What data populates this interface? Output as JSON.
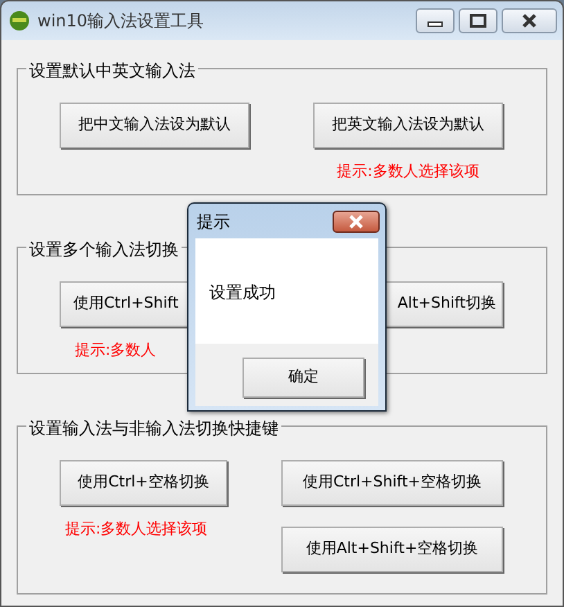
{
  "window": {
    "title": "win10输入法设置工具"
  },
  "groups": [
    {
      "title": "设置默认中英文输入法",
      "buttons": [
        {
          "label": "把中文输入法设为默认"
        },
        {
          "label": "把英文输入法设为默认"
        }
      ],
      "hint": {
        "text": "提示:多数人选择该项"
      }
    },
    {
      "title": "设置多个输入法切换",
      "buttons": [
        {
          "label": "使用Ctrl+Shift"
        },
        {
          "label": "Alt+Shift切换"
        }
      ],
      "hint": {
        "text": "提示:多数人"
      }
    },
    {
      "title": "设置输入法与非输入法切换快捷键",
      "buttons": [
        {
          "label": "使用Ctrl+空格切换"
        },
        {
          "label": "使用Ctrl+Shift+空格切换"
        },
        {
          "label": "使用Alt+Shift+空格切换"
        }
      ],
      "hint": {
        "text": "提示:多数人选择该项"
      }
    }
  ],
  "dialog": {
    "title": "提示",
    "message": "设置成功",
    "button": "确定"
  }
}
